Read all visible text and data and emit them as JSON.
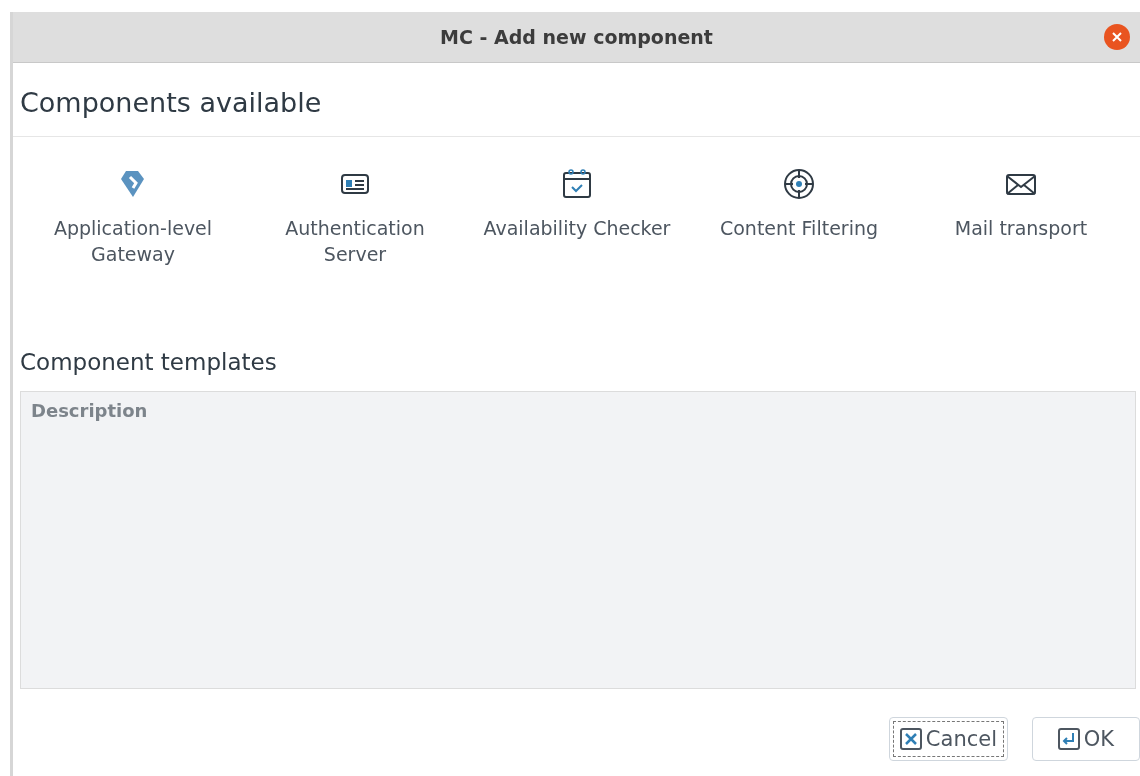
{
  "window": {
    "title": "MC - Add new component"
  },
  "components_heading": "Components available",
  "components": [
    {
      "kind": "gateway",
      "label": "Application-level Gateway"
    },
    {
      "kind": "idcard",
      "label": "Authentication Server"
    },
    {
      "kind": "calendar",
      "label": "Availability Checker"
    },
    {
      "kind": "target",
      "label": "Content Filtering"
    },
    {
      "kind": "mail",
      "label": "Mail transport"
    }
  ],
  "templates_heading": "Component templates",
  "description": {
    "label": "Description"
  },
  "buttons": [
    {
      "kind": "cancel",
      "label": "Cancel",
      "focused": true
    },
    {
      "kind": "ok",
      "label": "OK",
      "focused": false
    }
  ]
}
